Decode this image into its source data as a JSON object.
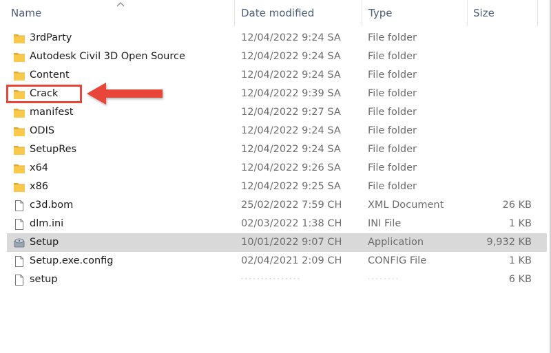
{
  "columns": {
    "name": "Name",
    "date": "Date modified",
    "type": "Type",
    "size": "Size"
  },
  "files": [
    {
      "name": "3rdParty",
      "date": "12/04/2022 9:24 SA",
      "type": "File folder",
      "size": "",
      "icon": "folder-icon"
    },
    {
      "name": "Autodesk Civil 3D Open Source",
      "date": "12/04/2022 9:24 SA",
      "type": "File folder",
      "size": "",
      "icon": "folder-icon"
    },
    {
      "name": "Content",
      "date": "12/04/2022 9:24 SA",
      "type": "File folder",
      "size": "",
      "icon": "folder-icon"
    },
    {
      "name": "Crack",
      "date": "12/04/2022 9:39 SA",
      "type": "File folder",
      "size": "",
      "icon": "folder-icon"
    },
    {
      "name": "manifest",
      "date": "12/04/2022 9:27 SA",
      "type": "File folder",
      "size": "",
      "icon": "folder-icon"
    },
    {
      "name": "ODIS",
      "date": "12/04/2022 9:24 SA",
      "type": "File folder",
      "size": "",
      "icon": "folder-icon"
    },
    {
      "name": "SetupRes",
      "date": "12/04/2022 9:24 SA",
      "type": "File folder",
      "size": "",
      "icon": "folder-icon"
    },
    {
      "name": "x64",
      "date": "12/04/2022 9:26 SA",
      "type": "File folder",
      "size": "",
      "icon": "folder-icon"
    },
    {
      "name": "x86",
      "date": "12/04/2022 9:25 SA",
      "type": "File folder",
      "size": "",
      "icon": "folder-icon"
    },
    {
      "name": "c3d.bom",
      "date": "25/02/2022 7:59 CH",
      "type": "XML Document",
      "size": "26 KB",
      "icon": "document-icon"
    },
    {
      "name": "dlm.ini",
      "date": "02/03/2022 1:38 CH",
      "type": "INI File",
      "size": "1 KB",
      "icon": "document-icon"
    },
    {
      "name": "Setup",
      "date": "10/01/2022 9:07 CH",
      "type": "Application",
      "size": "9,932 KB",
      "icon": "setup-app-icon",
      "selected": true
    },
    {
      "name": "Setup.exe.config",
      "date": "02/04/2021 2:09 CH",
      "type": "CONFIG File",
      "size": "1 KB",
      "icon": "document-icon"
    },
    {
      "name": "setup",
      "date": "",
      "type": "",
      "size": "6 KB",
      "icon": "document-icon",
      "blurred": true
    }
  ],
  "colors": {
    "folder": "#f8c94a",
    "folder_dark": "#e0a93a",
    "selection": "#d9d9d9",
    "highlight": "#e8443a",
    "header_text": "#4c607a"
  }
}
